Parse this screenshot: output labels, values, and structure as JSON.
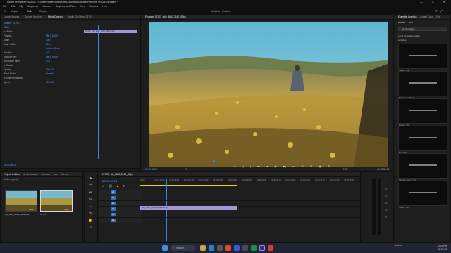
{
  "window": {
    "title": "Adobe Premiere Pro 2023 - C:\\Users\\Users\\OneDrive\\Documents\\Adobe\\Premiere Pro\\23.0\\Untitled *",
    "controls": [
      "—",
      "□",
      "✕"
    ]
  },
  "menu": [
    "File",
    "Edit",
    "Clip",
    "Sequence",
    "Markers",
    "Graphics and Titles",
    "View",
    "Window",
    "Help"
  ],
  "workspace": {
    "tabs": [
      "Import",
      "Edit",
      "Export"
    ],
    "active": "Edit",
    "title": "Untitled - Edited"
  },
  "effect_controls": {
    "tabs": [
      "Lumetri Scopes",
      "Source: (no clips)",
      "Effect Controls",
      "Audio Clip Mixer: 01703"
    ],
    "active_tab": "Effect Controls",
    "source_line": "Source · 01703 ...",
    "rows": [
      {
        "label": "Video",
        "value": ""
      },
      {
        "label": "fx  Motion",
        "value": ""
      },
      {
        "label": "Position",
        "value": "960.0  540.0"
      },
      {
        "label": "Scale",
        "value": "100.0"
      },
      {
        "label": "Scale Width",
        "value": "100.0"
      },
      {
        "label": "",
        "value": "Uniform Scale"
      },
      {
        "label": "Rotation",
        "value": "0.0"
      },
      {
        "label": "Anchor Point",
        "value": "960.0  540.0"
      },
      {
        "label": "Anti-flicker Filter",
        "value": "0.00"
      },
      {
        "label": "fx  Opacity",
        "value": ""
      },
      {
        "label": "Opacity",
        "value": "100.0 %"
      },
      {
        "label": "Blend Mode",
        "value": "Normal"
      },
      {
        "label": "fx  Time Remapping",
        "value": ""
      },
      {
        "label": "Speed",
        "value": "100.00%"
      }
    ],
    "mini_clip_label": "01703 · clip_3840_2160_30fps.mp4",
    "timecode": "00:00:08:23"
  },
  "program": {
    "tab_label": "Program: 01703 · clip_3840_2160_30fps",
    "timecode_left": "00:00:08:23",
    "fit": "Fit",
    "quality": "Full",
    "timecode_right": "00:00:51:11",
    "controls": [
      "⇤",
      "{",
      "}",
      "⏮",
      "◀",
      "▶",
      "▶|",
      "⏭",
      "⊕",
      "⊟",
      "▣",
      "⚙"
    ]
  },
  "essential_graphics": {
    "tabs": [
      "Essential Graphics",
      "Lumetri Color",
      "Text"
    ],
    "subtabs": [
      "Browse",
      "Edit"
    ],
    "button": "My Templates",
    "options": [
      "Local Templates Folder",
      "Libraries"
    ],
    "templates": [
      "Classic Title",
      "Bold Lower Third",
      "Modern Title",
      "Basic Title",
      "Simple Lower Third",
      "Boxed Title"
    ]
  },
  "project": {
    "tabs": [
      "Project: Untitled",
      "Media Browser",
      "Libraries",
      "Info",
      "Effects"
    ],
    "active_tab": "Project: Untitled",
    "bin": "Untitled.prproj",
    "items": [
      {
        "name": "clip_3840_2160_30fps.mp4",
        "duration": "51:11"
      },
      {
        "name": "01703",
        "duration": "51:11"
      }
    ]
  },
  "timeline": {
    "sequence_tab": "01703 · clip_3840_2160_30fps",
    "timecode": "00:00:08:23",
    "ruler": [
      "00:00",
      "00:00:04:00",
      "00:00:08:00",
      "00:00:12:00",
      "00:00:16:00",
      "00:00:20:00",
      "00:00:24:00",
      "00:00:28:00",
      "00:00:32:00",
      "00:00:36:00",
      "00:00:40:00",
      "00:00:44:00",
      "00:00:48:00",
      "00:00:52:00",
      "00:00:56:00"
    ],
    "tracks": [
      "V3",
      "V2",
      "V1",
      "A1",
      "A2",
      "A3"
    ],
    "clip_label": "clip_3840_2160_30fps.mp4 [V]",
    "clip_color": "#a594d6"
  },
  "taskbar": {
    "search": "Search",
    "time": "12:37 PM",
    "date": "06-07-23",
    "lang": "ENG IN"
  },
  "accent": "#2d8ceb"
}
